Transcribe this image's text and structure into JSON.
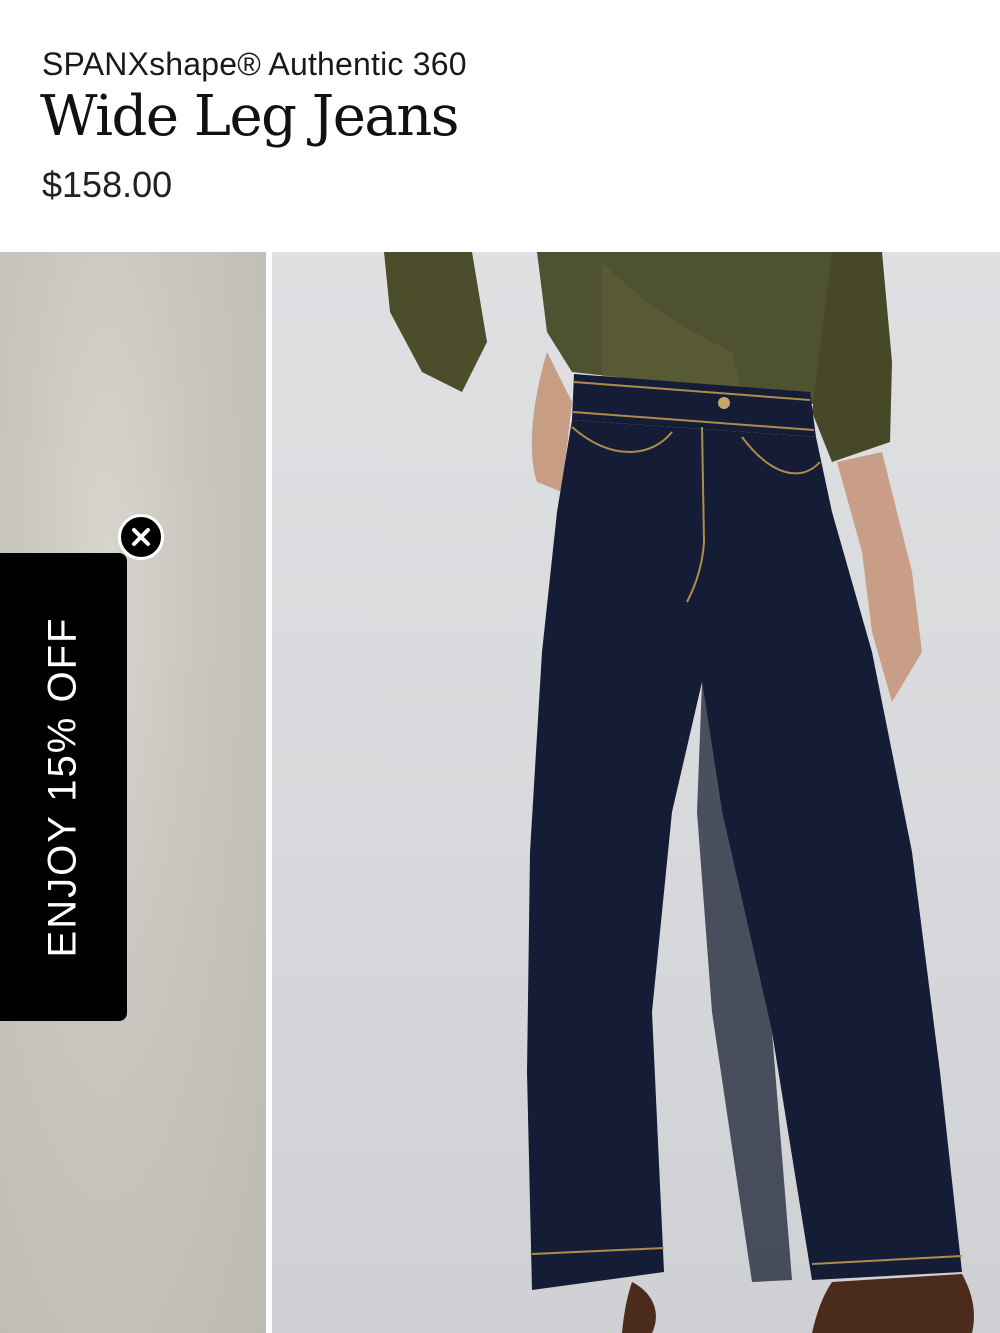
{
  "product": {
    "subtitle": "SPANXshape® Authentic 360",
    "title": "Wide Leg Jeans",
    "price": "$158.00"
  },
  "gallery": {
    "images": [
      "side-model-image",
      "main-model-image"
    ]
  },
  "promo": {
    "label": "ENJOY 15% OFF",
    "close_icon": "close-icon"
  },
  "colors": {
    "denim": "#141d35",
    "shirt": "#4b4d2b",
    "promo_bg": "#000000"
  }
}
